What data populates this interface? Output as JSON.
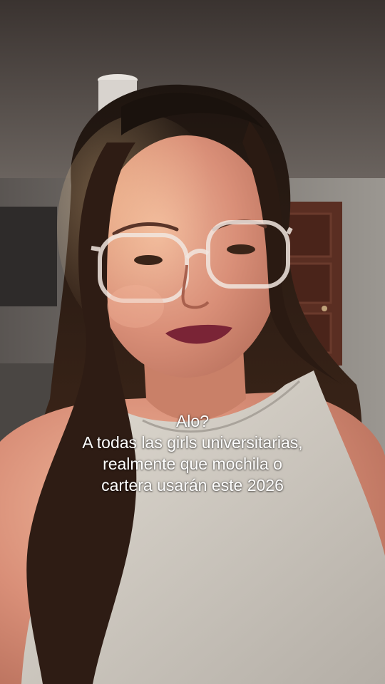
{
  "overlay": {
    "lines": [
      "Alo?",
      "A todas las girls universitarias,",
      "realmente que mochila o",
      "cartera usarán este 2026"
    ]
  },
  "colors": {
    "wall": "#8f8a86",
    "door": "#5a2e22",
    "hair": "#2a1a14",
    "skin": "#d9937e",
    "top": "#cbc5bc",
    "lips": "#7a2436",
    "caption_text": "#ffffff"
  },
  "icons": {
    "glasses": "glasses-icon"
  }
}
